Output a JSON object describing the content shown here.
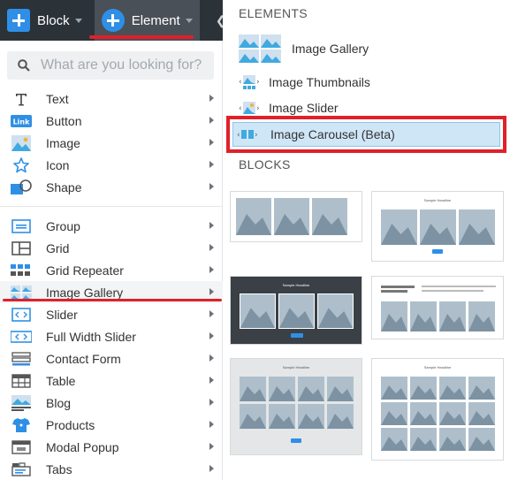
{
  "toolbar": {
    "block_label": "Block",
    "element_label": "Element"
  },
  "search": {
    "placeholder": "What are you looking for?"
  },
  "menu": {
    "group1": [
      {
        "label": "Text",
        "icon": "text-icon"
      },
      {
        "label": "Button",
        "icon": "button-icon",
        "badge": "Link"
      },
      {
        "label": "Image",
        "icon": "image-icon"
      },
      {
        "label": "Icon",
        "icon": "star-icon"
      },
      {
        "label": "Shape",
        "icon": "shape-icon"
      }
    ],
    "group2": [
      {
        "label": "Group",
        "icon": "group-icon"
      },
      {
        "label": "Grid",
        "icon": "grid-icon"
      },
      {
        "label": "Grid Repeater",
        "icon": "grid-repeater-icon"
      },
      {
        "label": "Image Gallery",
        "icon": "image-gallery-icon"
      },
      {
        "label": "Slider",
        "icon": "slider-icon"
      },
      {
        "label": "Full Width Slider",
        "icon": "full-width-slider-icon"
      },
      {
        "label": "Contact Form",
        "icon": "contact-form-icon"
      },
      {
        "label": "Table",
        "icon": "table-icon"
      },
      {
        "label": "Blog",
        "icon": "blog-icon"
      },
      {
        "label": "Products",
        "icon": "products-icon"
      },
      {
        "label": "Modal Popup",
        "icon": "modal-popup-icon"
      },
      {
        "label": "Tabs",
        "icon": "tabs-icon"
      }
    ]
  },
  "right": {
    "elements_title": "ELEMENTS",
    "blocks_title": "BLOCKS",
    "elements": [
      {
        "label": "Image Gallery"
      },
      {
        "label": "Image Thumbnails"
      },
      {
        "label": "Image Slider"
      },
      {
        "label": "Image Carousel (Beta)"
      }
    ],
    "block_heading": "Sample Headline"
  },
  "colors": {
    "accent": "#2f8fe6",
    "highlight_red": "#e0202a",
    "toolbar_bg": "#2b3238",
    "selected_bg": "#cfe6f7"
  }
}
